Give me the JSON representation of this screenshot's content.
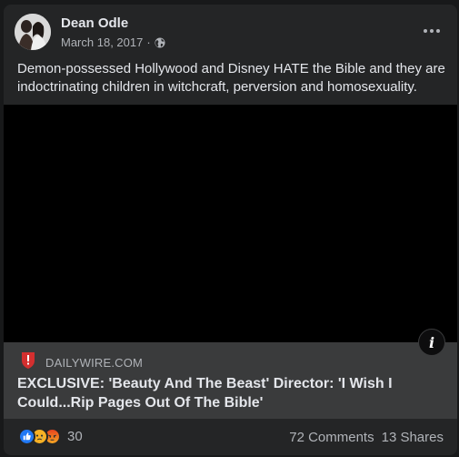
{
  "post": {
    "author": "Dean Odle",
    "date": "March 18, 2017",
    "date_separator": "·",
    "audience_icon": "globe-icon",
    "text": "Demon-possessed Hollywood and Disney HATE the Bible and they are indoctrinating children in witchcraft, perversion and homosexuality."
  },
  "media": {
    "info_label": "i",
    "background": "#000000"
  },
  "link": {
    "source": "DAILYWIRE.COM",
    "source_icon": "dailywire-shield-icon",
    "title": "EXCLUSIVE: 'Beauty And The Beast' Director: 'I Wish I Could...Rip Pages Out Of The Bible'"
  },
  "footer": {
    "reactions": [
      "like-reaction-icon",
      "sad-reaction-icon",
      "angry-reaction-icon"
    ],
    "reaction_count": "30",
    "comments": "72 Comments",
    "shares": "13 Shares"
  },
  "colors": {
    "card_bg": "#242526",
    "link_bg": "#3a3b3c",
    "text_primary": "#e4e6eb",
    "text_secondary": "#b0b3b8",
    "like_blue": "#2078f4",
    "sad_yellow": "#f7b125",
    "angry_orange": "#e9710f",
    "source_red": "#d32f2f"
  }
}
